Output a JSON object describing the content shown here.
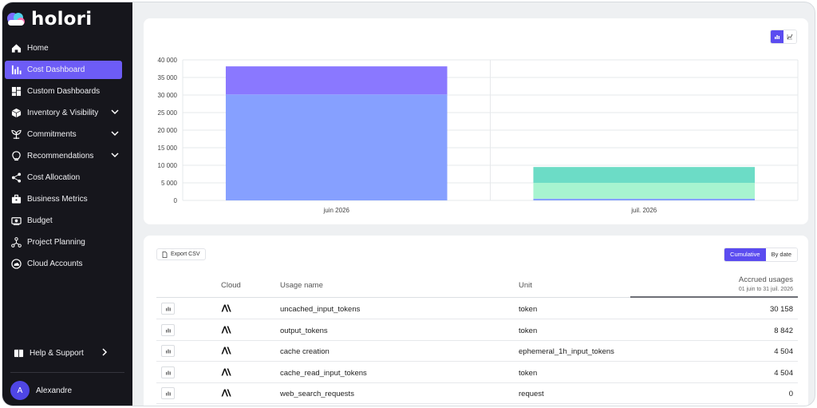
{
  "brand": {
    "name": "holori"
  },
  "nav": [
    {
      "label": "Home",
      "icon": "home-icon",
      "active": false,
      "chevron": false
    },
    {
      "label": "Cost Dashboard",
      "icon": "bar-chart-icon",
      "active": true,
      "chevron": false
    },
    {
      "label": "Custom Dashboards",
      "icon": "dashboard-icon",
      "active": false,
      "chevron": false
    },
    {
      "label": "Inventory & Visibility",
      "icon": "cube-icon",
      "active": false,
      "chevron": true
    },
    {
      "label": "Commitments",
      "icon": "plant-icon",
      "active": false,
      "chevron": true
    },
    {
      "label": "Recommendations",
      "icon": "lightbulb-icon",
      "active": false,
      "chevron": true
    },
    {
      "label": "Cost Allocation",
      "icon": "share-icon",
      "active": false,
      "chevron": false
    },
    {
      "label": "Business Metrics",
      "icon": "briefcase-icon",
      "active": false,
      "chevron": false
    },
    {
      "label": "Budget",
      "icon": "money-icon",
      "active": false,
      "chevron": false
    },
    {
      "label": "Project Planning",
      "icon": "network-icon",
      "active": false,
      "chevron": false
    },
    {
      "label": "Cloud Accounts",
      "icon": "cloud-account-icon",
      "active": false,
      "chevron": false
    }
  ],
  "help": {
    "label": "Help & Support",
    "icon": "book-icon"
  },
  "user": {
    "name": "Alexandre",
    "initial": "A"
  },
  "chart_data": {
    "type": "bar",
    "stacked": true,
    "categories": [
      "juin 2026",
      "juil. 2026"
    ],
    "series": [
      {
        "values": [
          30158,
          500
        ],
        "color": "#86a0ff"
      },
      {
        "values": [
          8000,
          0
        ],
        "color": "#8a78ff"
      },
      {
        "values": [
          0,
          4504
        ],
        "color": "#a7f4d0"
      },
      {
        "values": [
          0,
          4504
        ],
        "color": "#6cdcc6"
      }
    ],
    "yticks": [
      "0",
      "5 000",
      "10 000",
      "15 000",
      "20 000",
      "25 000",
      "30 000",
      "35 000",
      "40 000"
    ],
    "ylim": [
      0,
      40000
    ],
    "grid": true
  },
  "table": {
    "export_label": "Export CSV",
    "modes": {
      "cumulative": "Cumulative",
      "by_date": "By date"
    },
    "columns": {
      "cloud": "Cloud",
      "usage_name": "Usage name",
      "unit": "Unit",
      "accrued": "Accrued usages",
      "range": "01 juin to 31 juil. 2026"
    },
    "rows": [
      {
        "usage_name": "uncached_input_tokens",
        "unit": "token",
        "value": "30 158"
      },
      {
        "usage_name": "output_tokens",
        "unit": "token",
        "value": "8 842"
      },
      {
        "usage_name": "cache creation",
        "unit": "ephemeral_1h_input_tokens",
        "value": "4 504"
      },
      {
        "usage_name": "cache_read_input_tokens",
        "unit": "token",
        "value": "4 504"
      },
      {
        "usage_name": "web_search_requests",
        "unit": "request",
        "value": "0"
      }
    ]
  },
  "colors": {
    "accent": "#6d5cf6",
    "sidebar": "#16161c"
  }
}
